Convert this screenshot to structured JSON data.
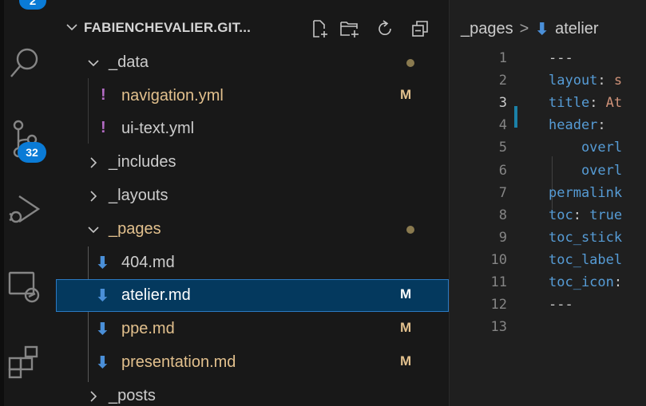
{
  "activity": {
    "top_badge": "2",
    "scm_badge": "32",
    "icons": [
      "explorer-icon",
      "search-icon",
      "source-control-icon",
      "run-debug-icon",
      "remote-explorer-icon",
      "extensions-icon"
    ]
  },
  "explorer": {
    "title": "FABIENCHEVALIER.GIT...",
    "tools": [
      "new-file-icon",
      "new-folder-icon",
      "refresh-icon",
      "collapse-all-icon"
    ],
    "items": [
      {
        "label": "_data",
        "type": "folder",
        "expanded": true,
        "status": "dot"
      },
      {
        "label": "navigation.yml",
        "type": "yml",
        "status": "M",
        "icon": "!"
      },
      {
        "label": "ui-text.yml",
        "type": "yml",
        "status": "",
        "icon": "!"
      },
      {
        "label": "_includes",
        "type": "folder",
        "expanded": false
      },
      {
        "label": "_layouts",
        "type": "folder",
        "expanded": false
      },
      {
        "label": "_pages",
        "type": "folder",
        "expanded": true,
        "status": "dot"
      },
      {
        "label": "404.md",
        "type": "md",
        "status": "",
        "icon": "⬇"
      },
      {
        "label": "atelier.md",
        "type": "md",
        "status": "M",
        "icon": "⬇",
        "selected": true
      },
      {
        "label": "ppe.md",
        "type": "md",
        "status": "M",
        "icon": "⬇"
      },
      {
        "label": "presentation.md",
        "type": "md",
        "status": "M",
        "icon": "⬇"
      },
      {
        "label": "_posts",
        "type": "folder",
        "expanded": false
      }
    ]
  },
  "editor": {
    "breadcrumb": [
      "_pages",
      "atelier"
    ],
    "breadcrumb_sep": ">",
    "lines": [
      {
        "n": "1",
        "parts": [
          {
            "t": "---",
            "c": "p"
          }
        ]
      },
      {
        "n": "2",
        "parts": [
          {
            "t": "layout",
            "c": "k"
          },
          {
            "t": ": ",
            "c": "p"
          },
          {
            "t": "s",
            "c": "s"
          }
        ]
      },
      {
        "n": "3",
        "parts": [
          {
            "t": "title",
            "c": "k"
          },
          {
            "t": ": ",
            "c": "p"
          },
          {
            "t": "At",
            "c": "s"
          }
        ]
      },
      {
        "n": "4",
        "parts": [
          {
            "t": "header",
            "c": "k"
          },
          {
            "t": ":",
            "c": "p"
          }
        ]
      },
      {
        "n": "5",
        "parts": [
          {
            "t": "    overl",
            "c": "k"
          }
        ]
      },
      {
        "n": "6",
        "parts": [
          {
            "t": "    overl",
            "c": "k"
          }
        ]
      },
      {
        "n": "7",
        "parts": [
          {
            "t": "permalink",
            "c": "k"
          }
        ]
      },
      {
        "n": "8",
        "parts": [
          {
            "t": "toc",
            "c": "k"
          },
          {
            "t": ": ",
            "c": "p"
          },
          {
            "t": "true",
            "c": "k"
          }
        ]
      },
      {
        "n": "9",
        "parts": [
          {
            "t": "toc_stick",
            "c": "k"
          }
        ]
      },
      {
        "n": "10",
        "parts": [
          {
            "t": "toc_label",
            "c": "k"
          }
        ]
      },
      {
        "n": "11",
        "parts": [
          {
            "t": "toc_icon",
            "c": "k"
          },
          {
            "t": ":",
            "c": "p"
          }
        ]
      },
      {
        "n": "12",
        "parts": [
          {
            "t": "---",
            "c": "p"
          }
        ]
      },
      {
        "n": "13",
        "parts": []
      }
    ],
    "active_line": "3"
  }
}
